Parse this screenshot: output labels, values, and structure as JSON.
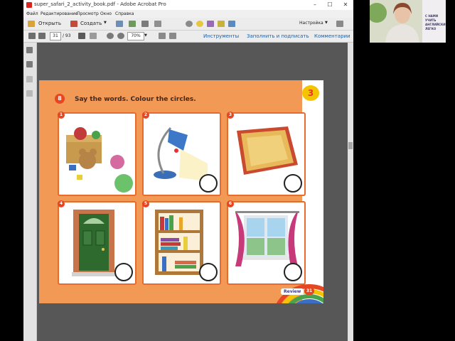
{
  "window": {
    "title": "super_safari_2_activity_book.pdf - Adobe Acrobat Pro",
    "controls": {
      "minimize": "–",
      "maximize": "☐",
      "close": "✕"
    }
  },
  "menu": [
    "Файл",
    "Редактирование",
    "Просмотр",
    "Окно",
    "Справка"
  ],
  "toolbar": {
    "open_label": "Открыть",
    "create_label": "Создать",
    "customize_label": "Настройка",
    "page_current": "31",
    "page_total": "/ 93",
    "zoom": "70%",
    "tools_label": "Инструменты",
    "fill_sign_label": "Заполнить и подписать",
    "comments_label": "Комментарии"
  },
  "page": {
    "instruction_number": "8",
    "instruction": "Say the words. Colour the circles.",
    "unit_badge": "3",
    "cards": [
      {
        "num": "1",
        "item": "toys",
        "circle": "filled",
        "circle_color": "#6cc26a"
      },
      {
        "num": "2",
        "item": "lamp",
        "circle": "empty"
      },
      {
        "num": "3",
        "item": "rug",
        "circle": "empty"
      },
      {
        "num": "4",
        "item": "door",
        "circle": "empty"
      },
      {
        "num": "5",
        "item": "bookcase",
        "circle": "empty"
      },
      {
        "num": "6",
        "item": "window",
        "circle": "empty"
      }
    ],
    "review_label": "Review",
    "page_number": "31"
  },
  "webcam": {
    "sign_text": "С НАМИ УЧИТЬ АНГЛИЙСКИЙ ЛЕГКО"
  },
  "colors": {
    "page_orange": "#f29a55",
    "card_border": "#e76a2e",
    "circle_fill": "#6cc26a",
    "link_blue": "#1a5fa8"
  }
}
